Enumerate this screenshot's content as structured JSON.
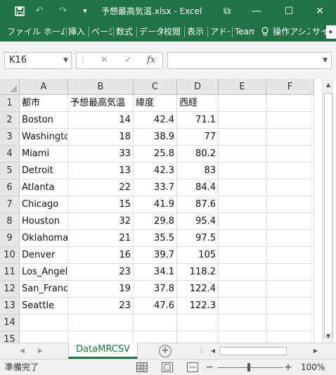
{
  "titlebar": {
    "save_icon": "save-icon",
    "undo_glyph": "↶",
    "redo_glyph": "↷",
    "customize_glyph": "▾",
    "title": "予想最高気温.xlsx - Excel",
    "ribbon_display_glyph": "⧉",
    "minimize_glyph": "—",
    "maximize_glyph": "☐",
    "close_glyph": "✕"
  },
  "ribbon": {
    "tabs": [
      "ファイル",
      "ホーム",
      "挿入",
      "ページ",
      "数式",
      "データ",
      "校閲",
      "表示",
      "アドイ",
      "Team",
      "操作アシス",
      "サイ"
    ],
    "tell_me_icon": "lightbulb-icon",
    "scroll_glyph": "▸"
  },
  "formula_bar": {
    "name_box": "K16",
    "cancel_glyph": "✕",
    "enter_glyph": "✓",
    "fx_label": "fx",
    "formula_value": ""
  },
  "columns": [
    "A",
    "B",
    "C",
    "D",
    "E",
    "F"
  ],
  "rows": [
    {
      "num": "1",
      "cells": [
        "都市",
        "予想最高気温",
        "緯度",
        "西経",
        "",
        ""
      ]
    },
    {
      "num": "2",
      "cells": [
        "Boston",
        "14",
        "42.4",
        "71.1",
        "",
        ""
      ]
    },
    {
      "num": "3",
      "cells": [
        "Washington",
        "18",
        "38.9",
        "77",
        "",
        ""
      ]
    },
    {
      "num": "4",
      "cells": [
        "Miami",
        "33",
        "25.8",
        "80.2",
        "",
        ""
      ]
    },
    {
      "num": "5",
      "cells": [
        "Detroit",
        "13",
        "42.3",
        "83",
        "",
        ""
      ]
    },
    {
      "num": "6",
      "cells": [
        "Atlanta",
        "22",
        "33.7",
        "84.4",
        "",
        ""
      ]
    },
    {
      "num": "7",
      "cells": [
        "Chicago",
        "15",
        "41.9",
        "87.6",
        "",
        ""
      ]
    },
    {
      "num": "8",
      "cells": [
        "Houston",
        "32",
        "29.8",
        "95.4",
        "",
        ""
      ]
    },
    {
      "num": "9",
      "cells": [
        "Oklahoma",
        "21",
        "35.5",
        "97.5",
        "",
        ""
      ]
    },
    {
      "num": "10",
      "cells": [
        "Denver",
        "16",
        "39.7",
        "105",
        "",
        ""
      ]
    },
    {
      "num": "11",
      "cells": [
        "Los_Angeles",
        "23",
        "34.1",
        "118.2",
        "",
        ""
      ]
    },
    {
      "num": "12",
      "cells": [
        "San_Francisco",
        "19",
        "37.8",
        "122.4",
        "",
        ""
      ]
    },
    {
      "num": "13",
      "cells": [
        "Seattle",
        "23",
        "47.6",
        "122.3",
        "",
        ""
      ]
    },
    {
      "num": "14",
      "cells": [
        "",
        "",
        "",
        "",
        "",
        ""
      ]
    },
    {
      "num": "15",
      "cells": [
        "",
        "",
        "",
        "",
        "",
        ""
      ]
    }
  ],
  "sheets": {
    "active": "DataMRCSV",
    "add_glyph": "+"
  },
  "statusbar": {
    "ready": "準備完了",
    "zoom_minus": "−",
    "zoom_plus": "+",
    "zoom_level": "100%"
  },
  "colors": {
    "accent": "#217346"
  }
}
